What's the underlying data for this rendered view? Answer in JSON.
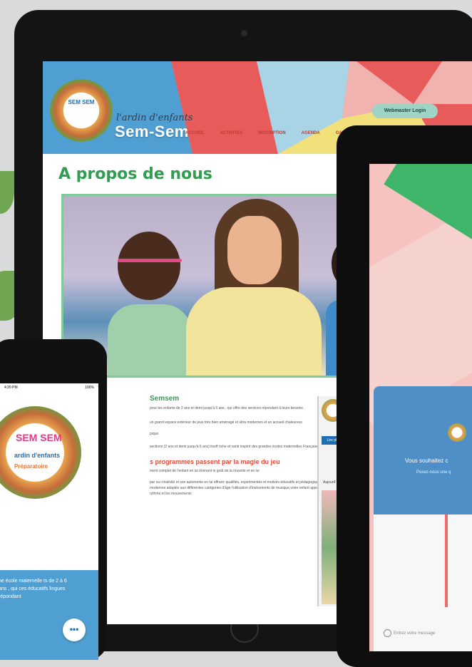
{
  "website": {
    "logo_text": "SEM SEM",
    "brand_subtitle": "l'ardin d'enfants",
    "brand_name": "Sem-Sem",
    "login_button": "Webmaster Login",
    "nav": [
      "ACCUEIL",
      "ACTIVITES",
      "INSCRIPTION",
      "AGENDA",
      "GALLERY"
    ],
    "page_title": "A propos de nous",
    "section_heading": "Semsem",
    "intro_text": "pour les enfants de 2 ans et demi jusqu'à 6 ans , qui offre des services répondant à leurs besoins .",
    "facilities_text": "un grand espace extérieur de jeux très bien aménagé et ultra modernes et un accueil chaleureux",
    "section_label": "pique",
    "program_text": "sections (2 ans et demi jusqu'à 6 ans) itself riche et varié inspiré des grandes écoles maternelles Françaises",
    "program_heading": "s programmes passent par la magie du jeu",
    "program_body": "ment complet de l'enfant en lui donnant le goût de la réussite et en lui",
    "list_text": "par sa créativité et son autonomie en lui offrant: qualifiés, expérimentés et motivés éducatifs et pédagogiques ultra modernes adaptés aux différentes catégories d'âge l'utilisation d'instruments de musique,votre enfant apprendra à la rythme et les mouvements",
    "sidebar_button": "Lire plus",
    "sidebar_label": "Aujourd'"
  },
  "phone": {
    "time": "4:20 PM",
    "battery": "100%",
    "logo_line1": "SEM SEM",
    "logo_line2": "ardin d'enfants",
    "logo_line3": "Préparatoire",
    "blue_text": "ne école maternelle ts de 2 à 6 ans , qui ces éducatifs lingues répondant",
    "chat_button": "•••"
  },
  "tablet2": {
    "chat_question": "Vous souhaitez c",
    "chat_sub": "Posez-nous une q",
    "message_placeholder": "Entrez votre message"
  }
}
